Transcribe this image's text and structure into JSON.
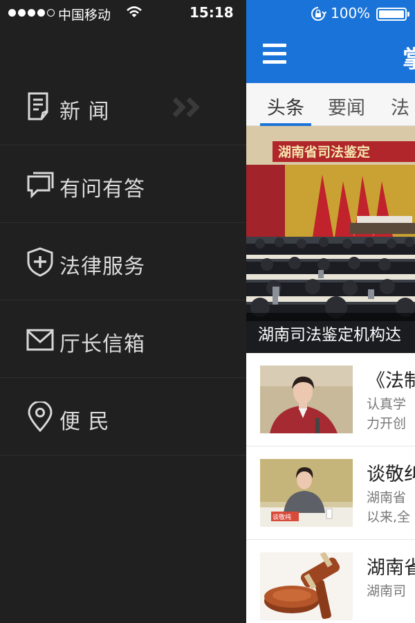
{
  "status_bar": {
    "carrier": "中国移动",
    "time": "15:18",
    "battery_percent": "100%"
  },
  "drawer": {
    "items": [
      {
        "label": "新 闻",
        "icon": "news-document-icon",
        "selected": true
      },
      {
        "label": "有问有答",
        "icon": "chat-bubble-icon"
      },
      {
        "label": "法律服务",
        "icon": "shield-plus-icon"
      },
      {
        "label": "厅长信箱",
        "icon": "mail-icon"
      },
      {
        "label": "便 民",
        "icon": "location-pin-icon"
      }
    ]
  },
  "header": {
    "title": "掌"
  },
  "tabs": [
    {
      "label": "头条",
      "active": true
    },
    {
      "label": "要闻"
    },
    {
      "label": "法"
    }
  ],
  "hero": {
    "banner_text": "湖南省司法鉴定",
    "caption": "湖南司法鉴定机构达"
  },
  "news": [
    {
      "title": "《法制",
      "desc_line1": "认真学",
      "desc_line2": "力开创"
    },
    {
      "title": "谈敬纠",
      "desc_line1": "湖南省",
      "desc_line2": "以来,全",
      "thumb_label": "谈敬纯"
    },
    {
      "title": "湖南省",
      "desc_line1": "湖南司"
    }
  ],
  "colors": {
    "accent": "#1a73d8",
    "drawer_bg": "#202020"
  }
}
